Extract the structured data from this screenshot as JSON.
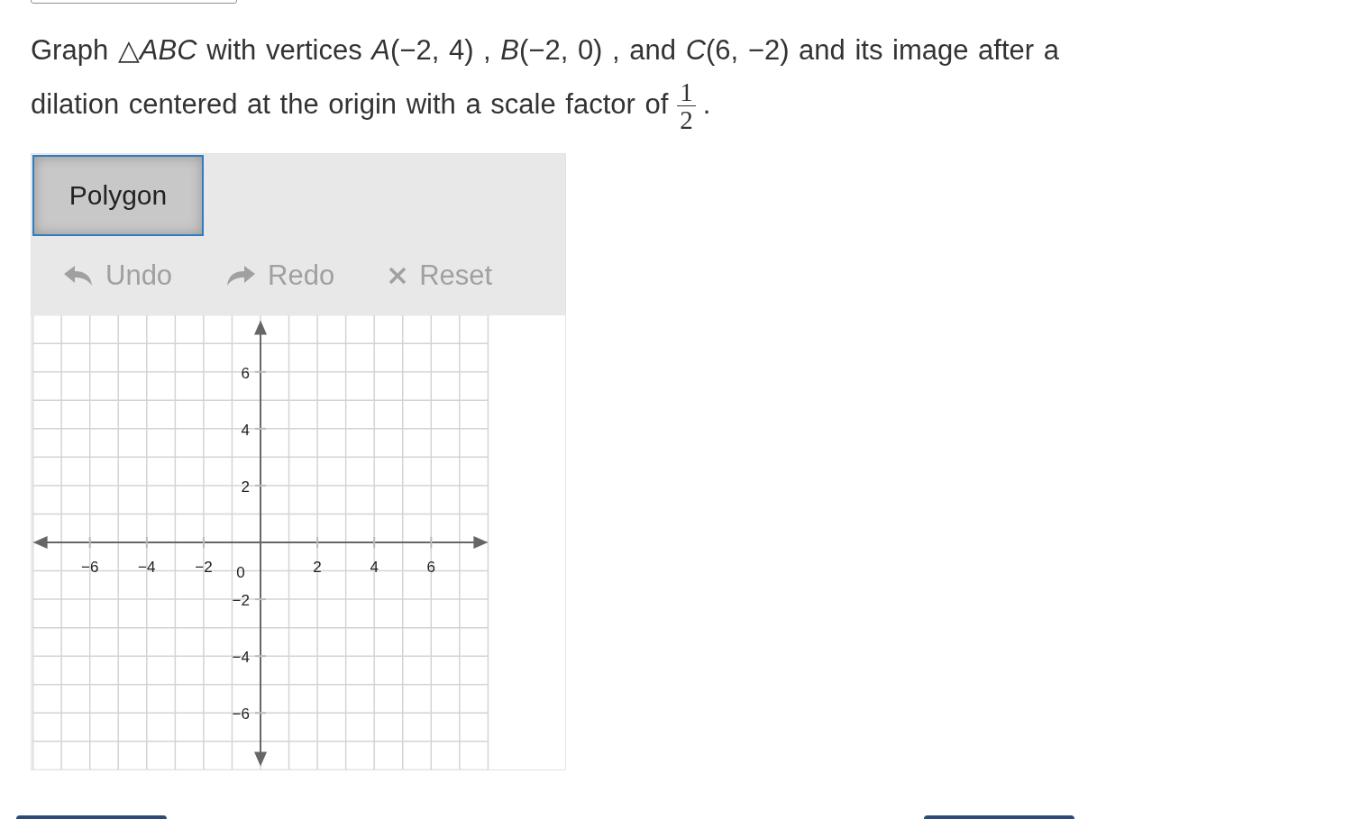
{
  "prompt": {
    "text": "Graph △*ABC* with vertices *A*(−2, 4) , *B*(−2, 0) , and *C*(6, −2) and its image after a dilation centered at the origin with a scale factor of",
    "fraction": {
      "numerator": "1",
      "denominator": "2"
    },
    "trailing": "."
  },
  "tools": [
    {
      "label": "Polygon",
      "selected": true
    }
  ],
  "actions": [
    {
      "kind": "undo",
      "label": "Undo",
      "disabled": true
    },
    {
      "kind": "redo",
      "label": "Redo",
      "disabled": true
    },
    {
      "kind": "reset",
      "label": "Reset",
      "disabled": true
    }
  ],
  "graph": {
    "origin_label": "0",
    "chart_data": {
      "type": "scatter",
      "grid": true,
      "xlim": [
        -8,
        8
      ],
      "ylim": [
        -8,
        8
      ],
      "xticks": [
        {
          "value": -6,
          "label": "−6"
        },
        {
          "value": -4,
          "label": "−4"
        },
        {
          "value": -2,
          "label": "−2"
        },
        2,
        4,
        6
      ],
      "yticks": [
        {
          "value": -6,
          "label": "−6"
        },
        {
          "value": -4,
          "label": "−4"
        },
        {
          "value": -2,
          "label": "−2"
        },
        2,
        4,
        6
      ]
    }
  }
}
